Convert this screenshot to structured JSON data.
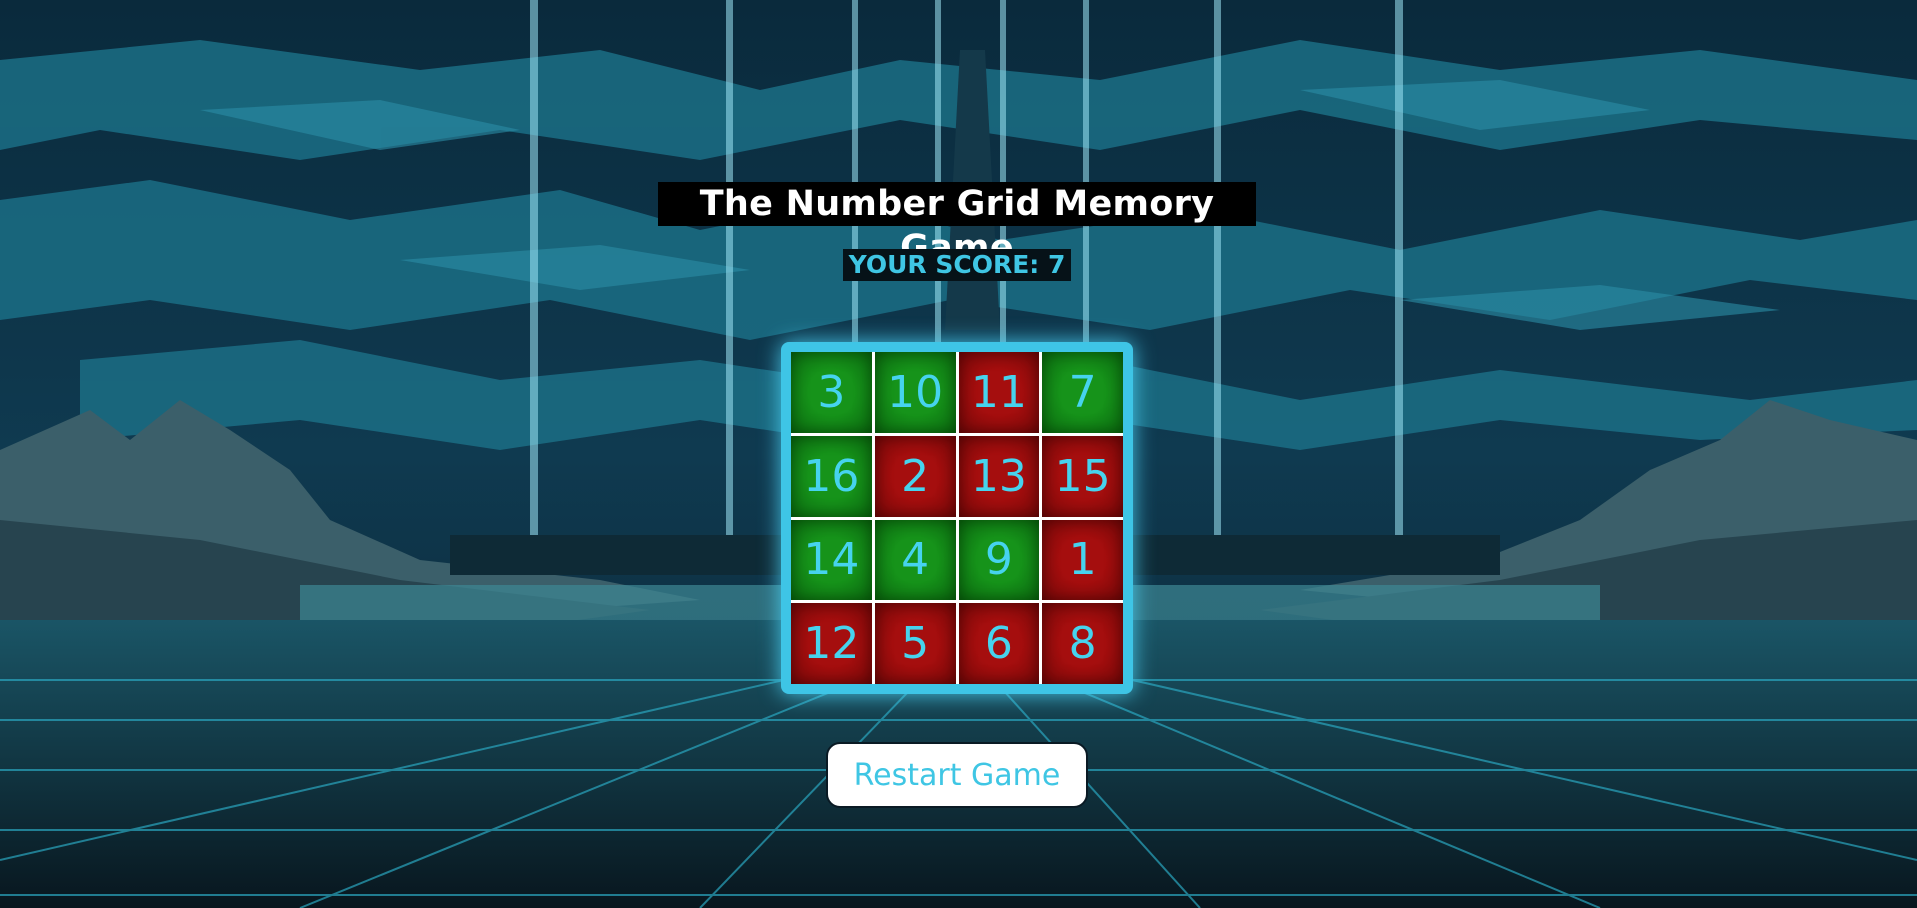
{
  "game": {
    "title": "The Number Grid Memory Game",
    "score_text": "YOUR SCORE: 7",
    "restart_label": "Restart Game"
  },
  "grid": [
    {
      "number": "3",
      "state": "correct"
    },
    {
      "number": "10",
      "state": "correct"
    },
    {
      "number": "11",
      "state": "wrong"
    },
    {
      "number": "7",
      "state": "correct"
    },
    {
      "number": "16",
      "state": "correct"
    },
    {
      "number": "2",
      "state": "wrong"
    },
    {
      "number": "13",
      "state": "wrong"
    },
    {
      "number": "15",
      "state": "wrong"
    },
    {
      "number": "14",
      "state": "correct"
    },
    {
      "number": "4",
      "state": "correct"
    },
    {
      "number": "9",
      "state": "correct"
    },
    {
      "number": "1",
      "state": "wrong"
    },
    {
      "number": "12",
      "state": "wrong"
    },
    {
      "number": "5",
      "state": "wrong"
    },
    {
      "number": "6",
      "state": "wrong"
    },
    {
      "number": "8",
      "state": "wrong"
    }
  ],
  "colors": {
    "correct": "#16931a",
    "wrong": "#a50e0e",
    "accent": "#3ec5e6"
  }
}
